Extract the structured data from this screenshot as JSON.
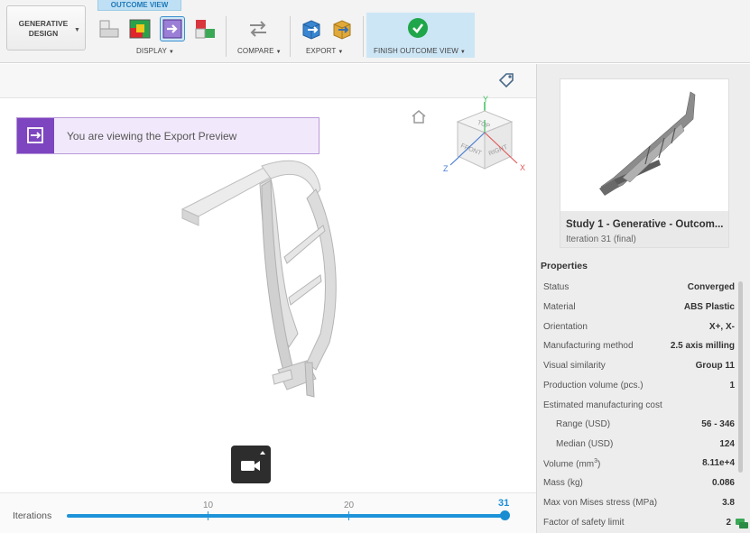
{
  "toolbar": {
    "workspace": {
      "label_line1": "GENERATIVE",
      "label_line2": "DESIGN"
    },
    "active_tab": "OUTCOME VIEW",
    "groups": {
      "display": "DISPLAY",
      "compare": "COMPARE",
      "export": "EXPORT",
      "finish": "FINISH OUTCOME VIEW"
    },
    "icons": {
      "display_1": "layer-blocks-icon",
      "display_2": "stress-color-icon",
      "display_3": "export-preview-icon",
      "display_4": "color-block-icon",
      "compare": "compare-arrows-icon",
      "export_1": "export-cube-blue-icon",
      "export_2": "export-cube-gold-icon",
      "finish": "check-circle-icon"
    }
  },
  "banner": {
    "text": "You are viewing the Export Preview",
    "icon": "export-arrow-icon",
    "accent_color": "#7d45c0"
  },
  "viewcube": {
    "axis_labels": {
      "x": "X",
      "y": "Y",
      "z": "Z"
    },
    "face_labels": {
      "top": "TOP",
      "front": "FRONT",
      "right": "RIGHT"
    }
  },
  "slider": {
    "label": "Iterations",
    "ticks": [
      "10",
      "20"
    ],
    "current": "31",
    "value_fraction": 1.0,
    "accent_color": "#1d93d9"
  },
  "outcome": {
    "title": "Study 1 - Generative - Outcom...",
    "subtitle": "Iteration 31 (final)"
  },
  "properties": {
    "heading": "Properties",
    "rows": [
      {
        "key": "Status",
        "value": "Converged"
      },
      {
        "key": "Material",
        "value": "ABS Plastic"
      },
      {
        "key": "Orientation",
        "value": "X+, X-"
      },
      {
        "key": "Manufacturing method",
        "value": "2.5 axis milling"
      },
      {
        "key": "Visual similarity",
        "value": "Group 11"
      },
      {
        "key": "Production volume (pcs.)",
        "value": "1"
      },
      {
        "key": "Estimated manufacturing cost",
        "value": ""
      },
      {
        "key": "Range (USD)",
        "value": "56 - 346"
      },
      {
        "key": "Median (USD)",
        "value": "124"
      },
      {
        "key": "Volume (mm",
        "key_sup": "3",
        "key_tail": ")",
        "value": "8.11e+4"
      },
      {
        "key": "Mass (kg)",
        "value": "0.086"
      },
      {
        "key": "Max von Mises stress (MPa)",
        "value": "3.8"
      },
      {
        "key": "Factor of safety limit",
        "value": "2"
      }
    ]
  }
}
